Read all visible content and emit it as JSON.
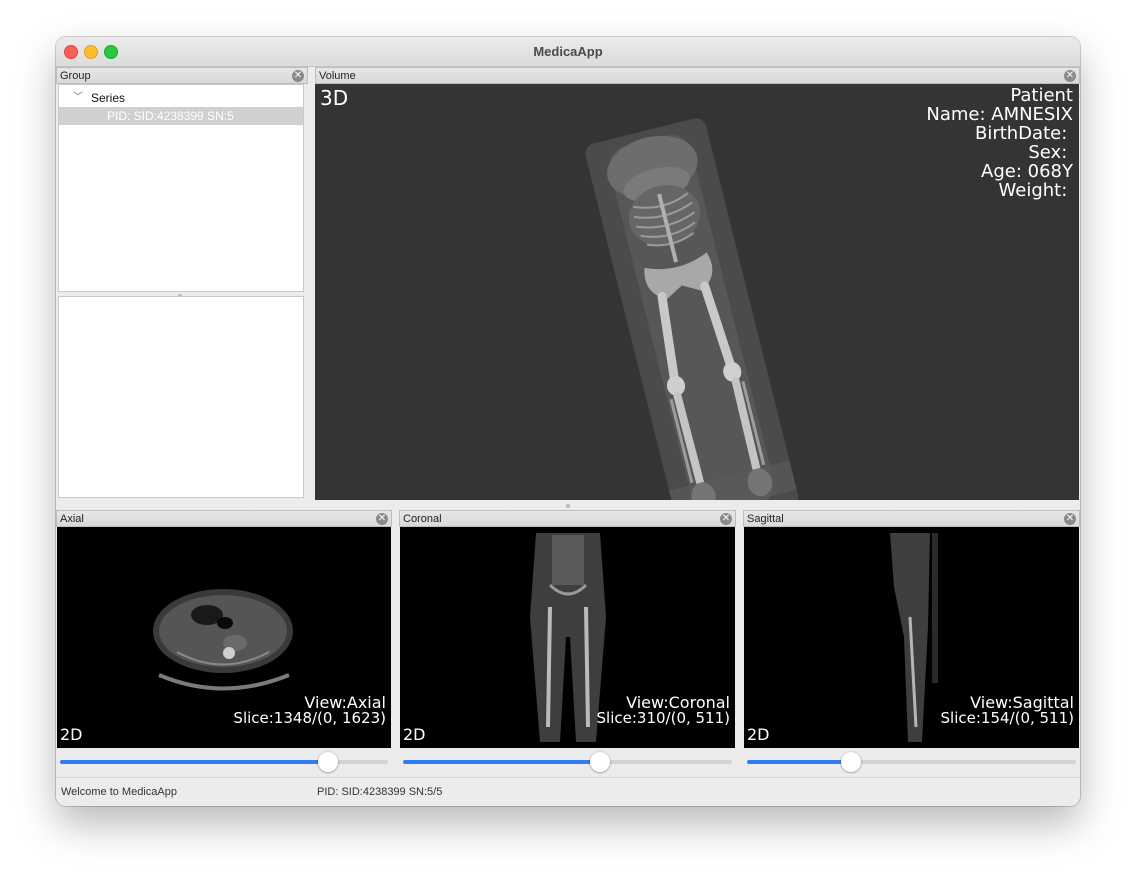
{
  "window": {
    "title": "MedicaApp"
  },
  "group_panel": {
    "title": "Group",
    "tree": {
      "root_label": "Series",
      "selected_item": "PID: SID:4238399 SN:5"
    }
  },
  "volume_panel": {
    "title": "Volume",
    "mode_label": "3D",
    "patient": {
      "heading": "Patient",
      "name": "Name: AMNESIX",
      "birthdate": "BirthDate: ",
      "sex": "Sex: ",
      "age": "Age: 068Y",
      "weight": "Weight: "
    }
  },
  "views": [
    {
      "title": "Axial",
      "view_label": "View:Axial",
      "slice_label": "Slice:1348/(0, 1623)",
      "mode_label": "2D",
      "slider_fraction": 0.818
    },
    {
      "title": "Coronal",
      "view_label": "View:Coronal",
      "slice_label": "Slice:310/(0, 511)",
      "mode_label": "2D",
      "slider_fraction": 0.598
    },
    {
      "title": "Sagittal",
      "view_label": "View:Sagittal",
      "slice_label": "Slice:154/(0, 511)",
      "mode_label": "2D",
      "slider_fraction": 0.316
    }
  ],
  "status": {
    "message": "Welcome to MedicaApp",
    "series_info": "PID: SID:4238399 SN:5/5"
  },
  "icons": {
    "close": "close-circle-icon",
    "expand": "chevron-down-icon"
  },
  "colors": {
    "accent": "#2f7cf6",
    "volume_bg": "#343434",
    "view_bg": "#000000"
  }
}
